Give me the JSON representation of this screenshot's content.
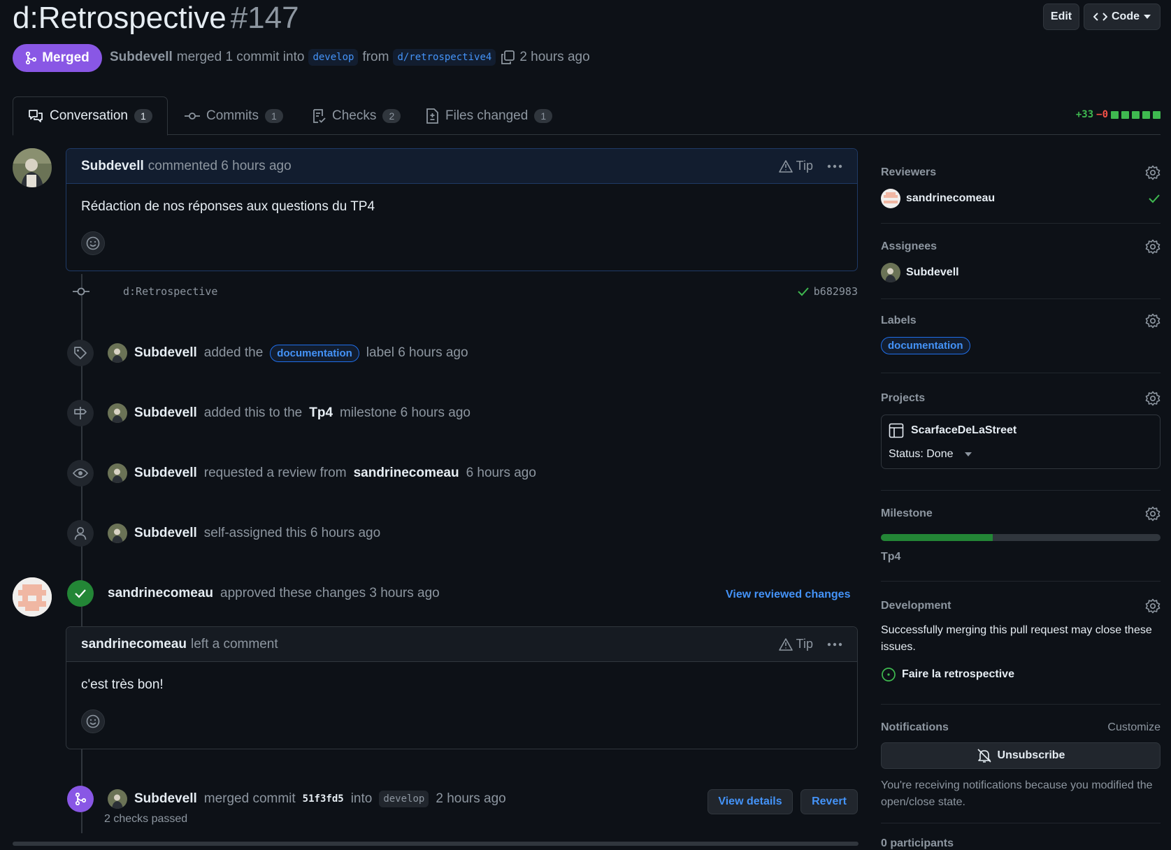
{
  "header": {
    "title": "d:Retrospective",
    "number": "#147",
    "edit_label": "Edit",
    "code_label": "Code",
    "status_label": "Merged",
    "author": "Subdevell",
    "merged_text": "merged 1 commit into",
    "base_branch": "develop",
    "from_text": "from",
    "head_branch": "d/retrospective4",
    "time": "2 hours ago"
  },
  "tabs": [
    {
      "label": "Conversation",
      "count": "1"
    },
    {
      "label": "Commits",
      "count": "1"
    },
    {
      "label": "Checks",
      "count": "2"
    },
    {
      "label": "Files changed",
      "count": "1"
    }
  ],
  "diffstat": {
    "additions": "+33",
    "deletions": "−0"
  },
  "first_comment": {
    "author": "Subdevell",
    "action": "commented 6 hours ago",
    "tip": "Tip",
    "body": "Rédaction de nos réponses aux questions du TP4"
  },
  "commit": {
    "message": "d:Retrospective",
    "sha": "b682983"
  },
  "events": {
    "label_event": {
      "actor": "Subdevell",
      "pre": "added the",
      "label": "documentation",
      "post": "label 6 hours ago"
    },
    "milestone_event": {
      "actor": "Subdevell",
      "pre": "added this to the",
      "milestone": "Tp4",
      "post": "milestone 6 hours ago"
    },
    "review_event": {
      "actor": "Subdevell",
      "pre": "requested a review from",
      "reviewer": "sandrinecomeau",
      "post": "6 hours ago"
    },
    "assign_event": {
      "actor": "Subdevell",
      "post": "self-assigned this 6 hours ago"
    }
  },
  "approval": {
    "actor": "sandrinecomeau",
    "text": "approved these changes 3 hours ago",
    "link": "View reviewed changes"
  },
  "review_comment": {
    "author": "sandrinecomeau",
    "action": "left a comment",
    "tip": "Tip",
    "body": "c'est très bon!"
  },
  "merge_event": {
    "actor": "Subdevell",
    "pre": "merged commit",
    "sha": "51f3fd5",
    "into": "into",
    "branch": "develop",
    "time": "2 hours ago",
    "checks": "2 checks passed",
    "details_label": "View details",
    "revert_label": "Revert"
  },
  "sidebar": {
    "reviewers": {
      "title": "Reviewers",
      "name": "sandrinecomeau"
    },
    "assignees": {
      "title": "Assignees",
      "name": "Subdevell"
    },
    "labels": {
      "title": "Labels",
      "label": "documentation"
    },
    "projects": {
      "title": "Projects",
      "name": "ScarfaceDeLaStreet",
      "status": "Status: Done"
    },
    "milestone": {
      "title": "Milestone",
      "name": "Tp4",
      "progress": 0.4
    },
    "development": {
      "title": "Development",
      "text": "Successfully merging this pull request may close these issues.",
      "issue": "Faire la retrospective"
    },
    "notifications": {
      "title": "Notifications",
      "customize": "Customize",
      "button": "Unsubscribe",
      "reason": "You're receiving notifications because you modified the open/close state."
    },
    "participants": "0 participants"
  },
  "colors": {
    "merged": "#8957e5",
    "link": "#4493f8",
    "success": "#238636",
    "background": "#0d1117"
  }
}
